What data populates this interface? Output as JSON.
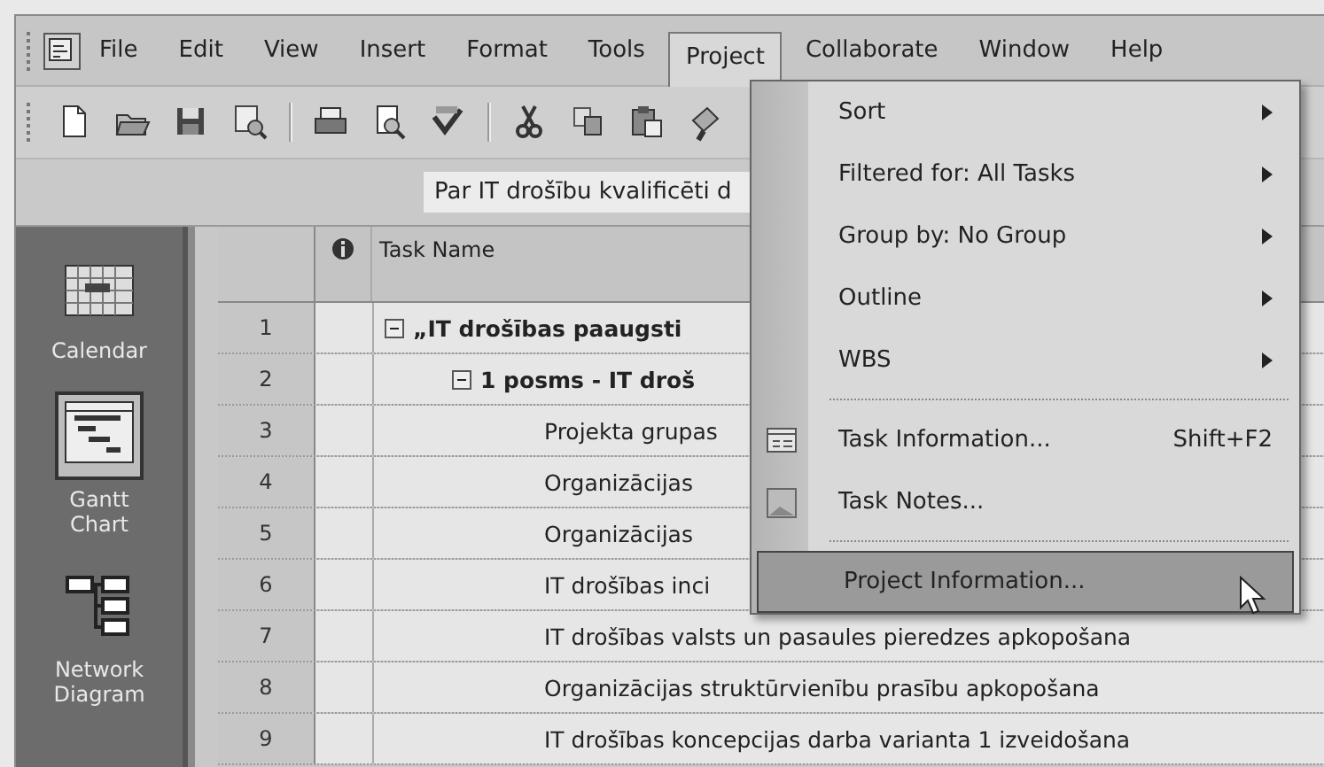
{
  "menu_bar": [
    {
      "label": "File",
      "selected": false
    },
    {
      "label": "Edit",
      "selected": false
    },
    {
      "label": "View",
      "selected": false
    },
    {
      "label": "Insert",
      "selected": false
    },
    {
      "label": "Format",
      "selected": false
    },
    {
      "label": "Tools",
      "selected": false
    },
    {
      "label": "Project",
      "selected": true
    },
    {
      "label": "Collaborate",
      "selected": false
    },
    {
      "label": "Window",
      "selected": false
    },
    {
      "label": "Help",
      "selected": false
    }
  ],
  "toolbar": [
    {
      "kind": "new"
    },
    {
      "kind": "open"
    },
    {
      "kind": "save"
    },
    {
      "kind": "find"
    },
    {
      "kind": "sep"
    },
    {
      "kind": "print"
    },
    {
      "kind": "preview"
    },
    {
      "kind": "spelling"
    },
    {
      "kind": "sep"
    },
    {
      "kind": "cut"
    },
    {
      "kind": "copy"
    },
    {
      "kind": "paste"
    },
    {
      "kind": "painter"
    }
  ],
  "entry_bar": {
    "value": "Par IT drošību kvalificēti d"
  },
  "view_bar": [
    {
      "label": "Calendar",
      "kind": "calendar",
      "selected": false
    },
    {
      "label": "Gantt Chart",
      "kind": "gantt",
      "selected": true
    },
    {
      "label": "Network Diagram",
      "kind": "network",
      "selected": false
    }
  ],
  "table": {
    "columns": [
      "Task Name"
    ],
    "rows": [
      {
        "id": "1",
        "name": "„IT drošības paaugsti",
        "summary": true,
        "expanded": true,
        "children": [
          {
            "id": "2",
            "name": "1 posms - IT droš",
            "summary": true,
            "expanded": true,
            "children": [
              {
                "id": "3",
                "name": "Projekta grupas",
                "summary": false
              },
              {
                "id": "4",
                "name": "Organizācijas",
                "summary": false
              },
              {
                "id": "5",
                "name": "Organizācijas",
                "summary": false
              },
              {
                "id": "6",
                "name": "IT drošības inci",
                "summary": false
              },
              {
                "id": "7",
                "name": "IT drošības valsts un pasaules pieredzes apkopošana",
                "summary": false
              },
              {
                "id": "8",
                "name": "Organizācijas struktūrvienību prasību apkopošana",
                "summary": false
              },
              {
                "id": "9",
                "name": "IT drošības koncepcijas darba varianta 1 izveidošana",
                "summary": false
              }
            ]
          }
        ]
      }
    ]
  },
  "project_menu": [
    {
      "kind": "submenu",
      "label": "Sort",
      "selected": false
    },
    {
      "kind": "submenu",
      "label": "Filtered for: All Tasks",
      "selected": false
    },
    {
      "kind": "submenu",
      "label": "Group by: No Group",
      "selected": false
    },
    {
      "kind": "submenu",
      "label": "Outline",
      "selected": false
    },
    {
      "kind": "submenu",
      "label": "WBS",
      "selected": false
    },
    {
      "kind": "separator"
    },
    {
      "kind": "info",
      "label": "Task Information...",
      "shortcut": "Shift+F2",
      "selected": false
    },
    {
      "kind": "notes",
      "label": "Task Notes...",
      "selected": false
    },
    {
      "kind": "separator"
    },
    {
      "kind": "command",
      "label": "Project Information...",
      "selected": true
    }
  ]
}
